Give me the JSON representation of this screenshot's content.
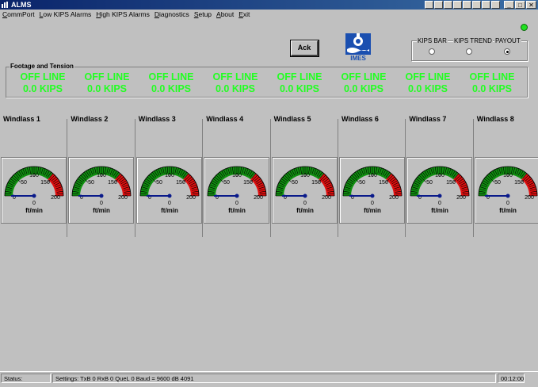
{
  "window": {
    "title": "ALMS"
  },
  "menu": [
    "CommPort",
    "Low KIPS Alarms",
    "High KIPS Alarms",
    "Diagnostics",
    "Setup",
    "About",
    "Exit"
  ],
  "toolbar": {
    "ack_label": "Ack",
    "logo_text": "IMES"
  },
  "display_mode": {
    "options": [
      "KIPS BAR",
      "KIPS TREND",
      "PAYOUT"
    ],
    "selected": "PAYOUT"
  },
  "footage": {
    "title": "Footage and Tension",
    "cells": [
      {
        "status": "OFF LINE",
        "kips": "0.0 KIPS"
      },
      {
        "status": "OFF LINE",
        "kips": "0.0 KIPS"
      },
      {
        "status": "OFF LINE",
        "kips": "0.0 KIPS"
      },
      {
        "status": "OFF LINE",
        "kips": "0.0 KIPS"
      },
      {
        "status": "OFF LINE",
        "kips": "0.0 KIPS"
      },
      {
        "status": "OFF LINE",
        "kips": "0.0 KIPS"
      },
      {
        "status": "OFF LINE",
        "kips": "0.0 KIPS"
      },
      {
        "status": "OFF LINE",
        "kips": "0.0 KIPS"
      }
    ]
  },
  "windlasses": [
    {
      "name": "Windlass 1",
      "ticks": [
        "0",
        "50",
        "100",
        "150",
        "200"
      ],
      "value": 0,
      "value_text": "0",
      "unit": "ft/min"
    },
    {
      "name": "Windlass 2",
      "ticks": [
        "0",
        "50",
        "100",
        "150",
        "200"
      ],
      "value": 0,
      "value_text": "0",
      "unit": "ft/min"
    },
    {
      "name": "Windlass 3",
      "ticks": [
        "0",
        "50",
        "100",
        "150",
        "200"
      ],
      "value": 0,
      "value_text": "0",
      "unit": "ft/min"
    },
    {
      "name": "Windlass 4",
      "ticks": [
        "0",
        "50",
        "100",
        "150",
        "200"
      ],
      "value": 0,
      "value_text": "0",
      "unit": "ft/min"
    },
    {
      "name": "Windlass 5",
      "ticks": [
        "0",
        "50",
        "100",
        "150",
        "200"
      ],
      "value": 0,
      "value_text": "0",
      "unit": "ft/min"
    },
    {
      "name": "Windlass 6",
      "ticks": [
        "0",
        "50",
        "100",
        "150",
        "200"
      ],
      "value": 0,
      "value_text": "0",
      "unit": "ft/min"
    },
    {
      "name": "Windlass 7",
      "ticks": [
        "0",
        "50",
        "100",
        "150",
        "200"
      ],
      "value": 0,
      "value_text": "0",
      "unit": "ft/min"
    },
    {
      "name": "Windlass 8",
      "ticks": [
        "0",
        "50",
        "100",
        "150",
        "200"
      ],
      "value": 0,
      "value_text": "0",
      "unit": "ft/min"
    }
  ],
  "statusbar": {
    "status_label": "Status:",
    "settings": "Settings: TxB  0 RxB  0 QueL  0 Baud = 9600  dB  4091",
    "clock": "00:12:00"
  },
  "colors": {
    "offline_text": "#22ff22",
    "gauge_green": "#109010",
    "gauge_red": "#e01010",
    "needle": "#0a1a8a"
  }
}
